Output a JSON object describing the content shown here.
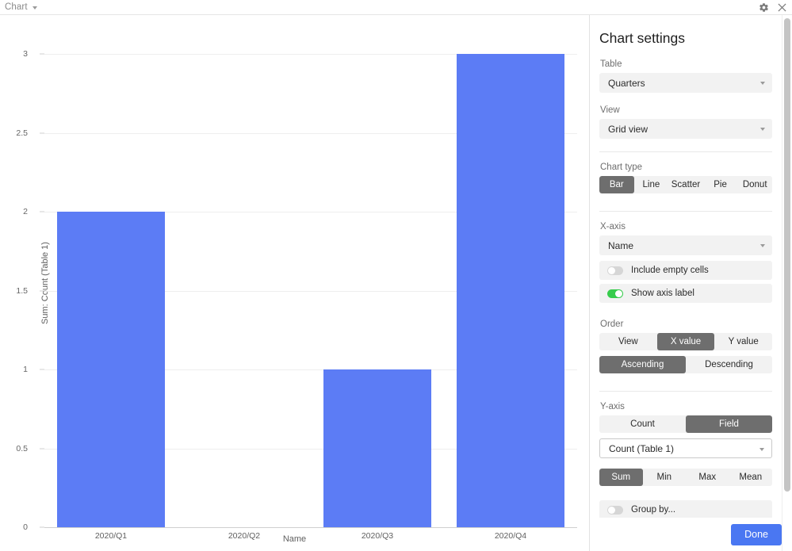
{
  "topbar": {
    "title": "Chart",
    "caret_icon": "chevron-down-icon",
    "gear_icon": "gear-icon",
    "close_icon": "close-icon"
  },
  "chart_data": {
    "type": "bar",
    "title": "",
    "categories": [
      "2020/Q1",
      "2020/Q2",
      "2020/Q3",
      "2020/Q4"
    ],
    "values": [
      2,
      0,
      1,
      3
    ],
    "series": [
      {
        "name": "Sum: Count (Table 1)",
        "values": [
          2,
          0,
          1,
          3
        ]
      }
    ],
    "xlabel": "Name",
    "ylabel": "Sum: Count (Table 1)",
    "ylim": [
      0,
      3
    ],
    "yticks": [
      "0",
      "0.5",
      "1",
      "1.5",
      "2",
      "2.5",
      "3"
    ],
    "ytick_values": [
      0,
      0.5,
      1,
      1.5,
      2,
      2.5,
      3
    ],
    "grid": true,
    "legend": false,
    "bar_color": "#5c7cf5"
  },
  "panel": {
    "heading": "Chart settings",
    "table": {
      "label": "Table",
      "value": "Quarters"
    },
    "view": {
      "label": "View",
      "value": "Grid view"
    },
    "chart_type": {
      "label": "Chart type",
      "options": [
        "Bar",
        "Line",
        "Scatter",
        "Pie",
        "Donut"
      ],
      "selected": "Bar"
    },
    "x_axis": {
      "label": "X-axis",
      "field": "Name",
      "include_empty_cells": {
        "label": "Include empty cells",
        "on": false
      },
      "show_axis_label": {
        "label": "Show axis label",
        "on": true
      }
    },
    "order": {
      "label": "Order",
      "by_options": [
        "View",
        "X value",
        "Y value"
      ],
      "by_selected": "X value",
      "dir_options": [
        "Ascending",
        "Descending"
      ],
      "dir_selected": "Ascending"
    },
    "y_axis": {
      "label": "Y-axis",
      "mode_options": [
        "Count",
        "Field"
      ],
      "mode_selected": "Field",
      "field": "Count (Table 1)",
      "agg_options": [
        "Sum",
        "Min",
        "Max",
        "Mean"
      ],
      "agg_selected": "Sum",
      "group_by": {
        "label": "Group by...",
        "on": false
      }
    },
    "done_label": "Done",
    "accent_color": "#4a77f2",
    "toggle_on_color": "#37cc4c",
    "segment_active_color": "#6e6e6e"
  }
}
